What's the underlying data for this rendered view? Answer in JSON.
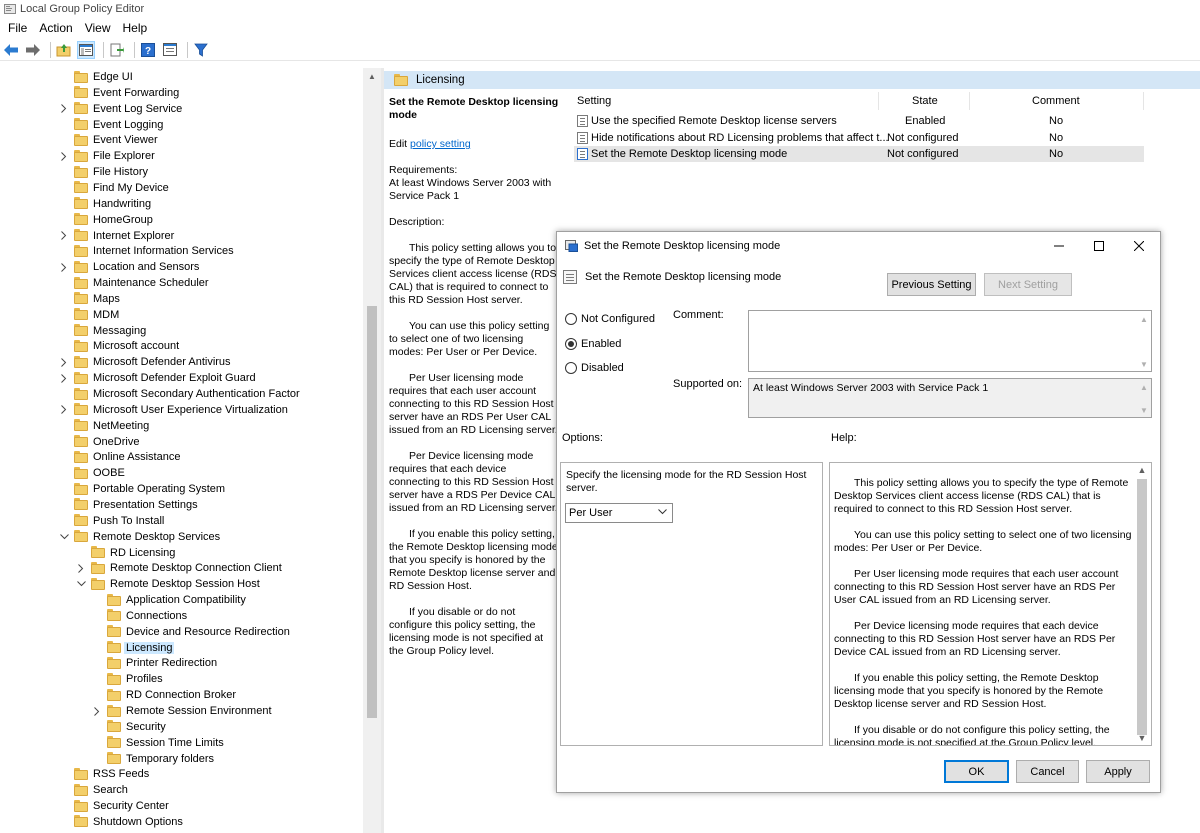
{
  "window": {
    "title": "Local Group Policy Editor"
  },
  "menu": [
    "File",
    "Action",
    "View",
    "Help"
  ],
  "toolbar": {
    "icons": [
      "back-arrow-icon",
      "forward-arrow-icon",
      "up-folder-icon",
      "show-hide-tree-icon",
      "export-list-icon",
      "help-icon",
      "properties-icon",
      "filter-icon"
    ]
  },
  "tree": {
    "items": [
      {
        "label": "Edge UI",
        "level": 0,
        "expander": false
      },
      {
        "label": "Event Forwarding",
        "level": 0,
        "expander": false
      },
      {
        "label": "Event Log Service",
        "level": 0,
        "expander": true
      },
      {
        "label": "Event Logging",
        "level": 0,
        "expander": false
      },
      {
        "label": "Event Viewer",
        "level": 0,
        "expander": false
      },
      {
        "label": "File Explorer",
        "level": 0,
        "expander": true
      },
      {
        "label": "File History",
        "level": 0,
        "expander": false
      },
      {
        "label": "Find My Device",
        "level": 0,
        "expander": false
      },
      {
        "label": "Handwriting",
        "level": 0,
        "expander": false
      },
      {
        "label": "HomeGroup",
        "level": 0,
        "expander": false
      },
      {
        "label": "Internet Explorer",
        "level": 0,
        "expander": true
      },
      {
        "label": "Internet Information Services",
        "level": 0,
        "expander": false
      },
      {
        "label": "Location and Sensors",
        "level": 0,
        "expander": true
      },
      {
        "label": "Maintenance Scheduler",
        "level": 0,
        "expander": false
      },
      {
        "label": "Maps",
        "level": 0,
        "expander": false
      },
      {
        "label": "MDM",
        "level": 0,
        "expander": false
      },
      {
        "label": "Messaging",
        "level": 0,
        "expander": false
      },
      {
        "label": "Microsoft account",
        "level": 0,
        "expander": false
      },
      {
        "label": "Microsoft Defender Antivirus",
        "level": 0,
        "expander": true
      },
      {
        "label": "Microsoft Defender Exploit Guard",
        "level": 0,
        "expander": true
      },
      {
        "label": "Microsoft Secondary Authentication Factor",
        "level": 0,
        "expander": false
      },
      {
        "label": "Microsoft User Experience Virtualization",
        "level": 0,
        "expander": true
      },
      {
        "label": "NetMeeting",
        "level": 0,
        "expander": false
      },
      {
        "label": "OneDrive",
        "level": 0,
        "expander": false
      },
      {
        "label": "Online Assistance",
        "level": 0,
        "expander": false
      },
      {
        "label": "OOBE",
        "level": 0,
        "expander": false
      },
      {
        "label": "Portable Operating System",
        "level": 0,
        "expander": false
      },
      {
        "label": "Presentation Settings",
        "level": 0,
        "expander": false
      },
      {
        "label": "Push To Install",
        "level": 0,
        "expander": false
      },
      {
        "label": "Remote Desktop Services",
        "level": 0,
        "expander": "open"
      },
      {
        "label": "RD Licensing",
        "level": 1,
        "expander": false
      },
      {
        "label": "Remote Desktop Connection Client",
        "level": 1,
        "expander": true
      },
      {
        "label": "Remote Desktop Session Host",
        "level": 1,
        "expander": "open"
      },
      {
        "label": "Application Compatibility",
        "level": 2,
        "expander": false
      },
      {
        "label": "Connections",
        "level": 2,
        "expander": false
      },
      {
        "label": "Device and Resource Redirection",
        "level": 2,
        "expander": false
      },
      {
        "label": "Licensing",
        "level": 2,
        "expander": false,
        "selected": true
      },
      {
        "label": "Printer Redirection",
        "level": 2,
        "expander": false
      },
      {
        "label": "Profiles",
        "level": 2,
        "expander": false
      },
      {
        "label": "RD Connection Broker",
        "level": 2,
        "expander": false
      },
      {
        "label": "Remote Session Environment",
        "level": 2,
        "expander": true
      },
      {
        "label": "Security",
        "level": 2,
        "expander": false
      },
      {
        "label": "Session Time Limits",
        "level": 2,
        "expander": false
      },
      {
        "label": "Temporary folders",
        "level": 2,
        "expander": false
      },
      {
        "label": "RSS Feeds",
        "level": 0,
        "expander": false
      },
      {
        "label": "Search",
        "level": 0,
        "expander": false
      },
      {
        "label": "Security Center",
        "level": 0,
        "expander": false
      },
      {
        "label": "Shutdown Options",
        "level": 0,
        "expander": false
      }
    ]
  },
  "right_pane": {
    "header": "Licensing",
    "ext": {
      "title": "Set the Remote Desktop licensing mode",
      "edit_prefix": "Edit ",
      "edit_link": "policy setting",
      "requirements_label": "Requirements:",
      "requirements": "At least Windows Server 2003 with Service Pack 1",
      "description_label": "Description:",
      "paragraphs": [
        "This policy setting allows you to specify the type of Remote Desktop Services client access license (RDS CAL) that is required to connect to this RD Session Host server.",
        "You can use this policy setting to select one of two licensing modes: Per User or Per Device.",
        "Per User licensing mode requires that each user account connecting to this RD Session Host server have an RDS Per User CAL issued from an RD Licensing server.",
        "Per Device licensing mode requires that each device connecting to this RD Session Host server have a RDS Per Device CAL issued from an RD Licensing server.",
        "If you enable this policy setting, the Remote Desktop licensing mode that you specify is honored by the Remote Desktop license server and RD Session Host.",
        "If you disable or do not configure this policy setting, the licensing mode is not specified at the Group Policy level."
      ]
    },
    "columns": {
      "setting": "Setting",
      "state": "State",
      "comment": "Comment"
    },
    "rows": [
      {
        "setting": "Use the specified Remote Desktop license servers",
        "state": "Enabled",
        "comment": "No"
      },
      {
        "setting": "Hide notifications about RD Licensing problems that affect t...",
        "state": "Not configured",
        "comment": "No"
      },
      {
        "setting": "Set the Remote Desktop licensing mode",
        "state": "Not configured",
        "comment": "No",
        "selected": true
      }
    ]
  },
  "dialog": {
    "title": "Set the Remote Desktop licensing mode",
    "subtitle": "Set the Remote Desktop licensing mode",
    "prev_button": "Previous Setting",
    "next_button": "Next Setting",
    "radios": [
      {
        "label": "Not Configured",
        "checked": false
      },
      {
        "label": "Enabled",
        "checked": true
      },
      {
        "label": "Disabled",
        "checked": false
      }
    ],
    "comment_label": "Comment:",
    "comment_value": "",
    "supported_label": "Supported on:",
    "supported_value": "At least Windows Server 2003 with Service Pack 1",
    "options_label": "Options:",
    "help_label": "Help:",
    "option_text": "Specify the licensing mode for the RD Session Host server.",
    "licensing_mode": "Per User",
    "help_paragraphs": [
      "This policy setting allows you to specify the type of Remote Desktop Services client access license (RDS CAL) that is required to connect to this RD Session Host server.",
      "You can use this policy setting to select one of two licensing modes: Per User or Per Device.",
      "Per User licensing mode requires that each user account connecting to this RD Session Host server have an RDS Per User CAL issued from an RD Licensing server.",
      "Per Device licensing mode requires that each device connecting to this RD Session Host server have an RDS Per Device CAL issued from an RD Licensing server.",
      "If you enable this policy setting, the Remote Desktop licensing mode that you specify is honored by the Remote Desktop license server and RD Session Host.",
      "If you disable or do not configure this policy setting, the licensing mode is not specified at the Group Policy level."
    ],
    "ok": "OK",
    "cancel": "Cancel",
    "apply": "Apply"
  },
  "colors": {
    "selection": "#cce8ff",
    "header_bar": "#d4e6f6",
    "link": "#0066cc",
    "folder": "#f3cf6a"
  }
}
